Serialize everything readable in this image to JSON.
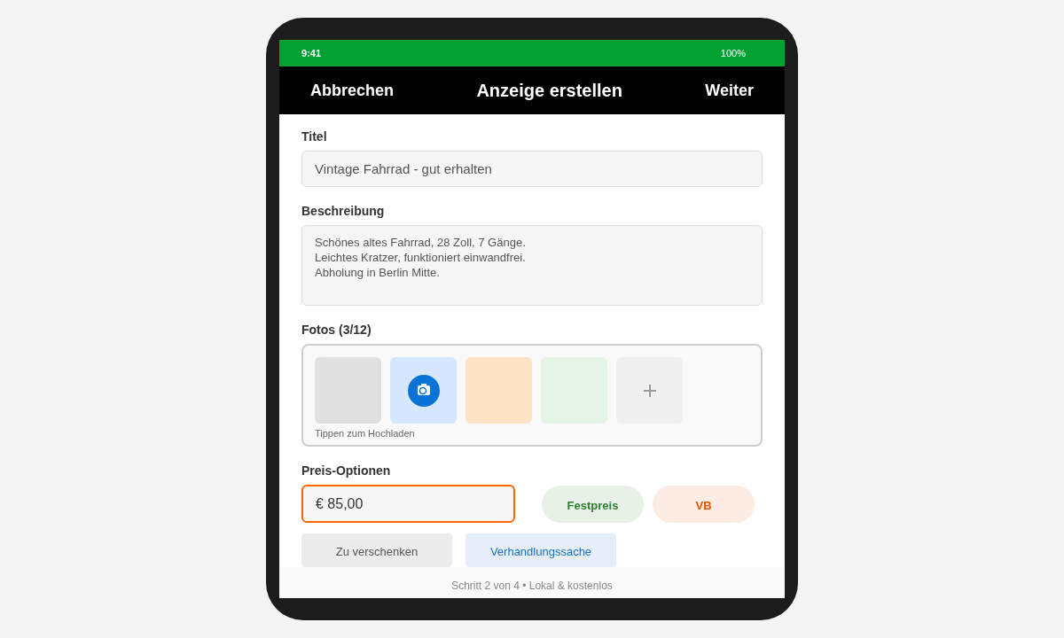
{
  "status_bar": {
    "time": "9:41",
    "battery": "100%"
  },
  "header": {
    "cancel": "Abbrechen",
    "title": "Anzeige erstellen",
    "next": "Weiter"
  },
  "fields": [
    {
      "label": "Titel",
      "kind": "input",
      "value": "Vintage Fahrrad - gut erhalten"
    },
    {
      "label": "Beschreibung",
      "kind": "textarea",
      "value": "Schönes altes Fahrrad, 28 Zoll, 7 Gänge.\nLeichtes Kratzer, funktioniert einwandfrei.\nAbholung in Berlin Mitte."
    }
  ],
  "photos": {
    "label": "Fotos (3/12)",
    "hint": "Tippen zum Hochladen",
    "tiles": [
      {
        "kind": "blank",
        "color": "#e0e0e0"
      },
      {
        "kind": "camera",
        "color": "#d6e8ff"
      },
      {
        "kind": "blank",
        "color": "#fde3c5"
      },
      {
        "kind": "blank",
        "color": "#e6f4e7"
      },
      {
        "kind": "add",
        "color": "#f0f0f0"
      }
    ]
  },
  "price": {
    "label": "Preis-Optionen",
    "value": "€ 85,00",
    "focused": true,
    "chips": [
      {
        "label": "Festpreis",
        "color": "#2e7d32"
      },
      {
        "label": "VB",
        "color": "#e65100"
      }
    ],
    "buttons": [
      {
        "label": "Zu verschenken",
        "color": "#555555"
      },
      {
        "label": "Verhandlungssache",
        "color": "#1a6fc9"
      }
    ]
  },
  "footer": "Schritt 2 von 4 • Lokal & kostenlos"
}
